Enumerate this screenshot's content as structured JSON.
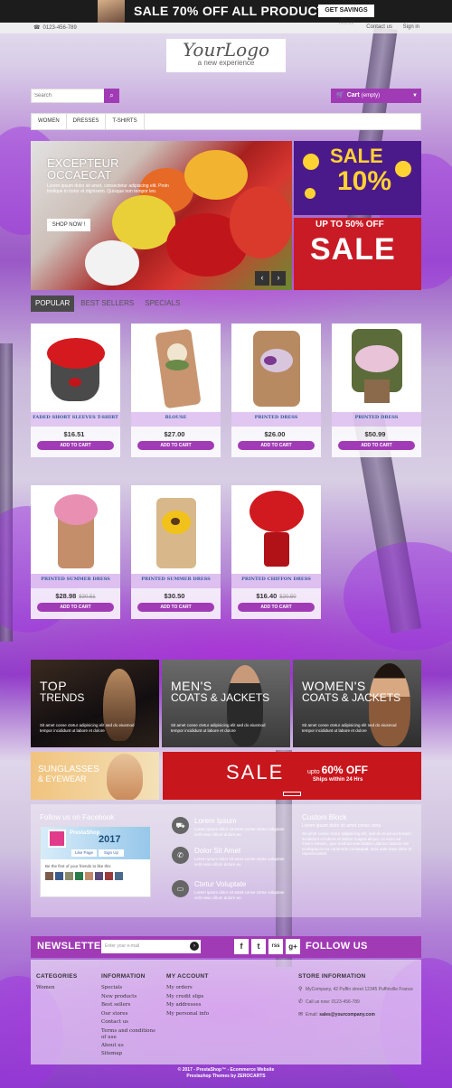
{
  "promo_banner": {
    "text": "SALE 70% OFF ALL PRODUCTS",
    "button": "GET SAVINGS NOW"
  },
  "topbar": {
    "phone": "0123-456-789",
    "contact": "Contact us",
    "signin": "Sign in"
  },
  "logo": {
    "name": "YourLogo",
    "tagline": "a new experience"
  },
  "search": {
    "placeholder": "Search",
    "icon": "search-icon"
  },
  "cart": {
    "label": "Cart",
    "status": "(empty)"
  },
  "menu": [
    "WOMEN",
    "DRESSES",
    "T-SHIRTS"
  ],
  "slider": {
    "heading_1": "EXCEPTEUR",
    "heading_2": "OCCAECAT",
    "text": "Lorem ipsum dolor sit amet, consectetur adipiscing elit. Proin tristique in tortor et dignissim. Quisque non tempor leo.",
    "button": "SHOP NOW !",
    "prev": "‹",
    "next": "›"
  },
  "side_ads": {
    "ad1_line1": "SALE",
    "ad1_line2": "10%",
    "ad2_line1": "UP TO 50% OFF",
    "ad2_line2": "SALE"
  },
  "tabs": [
    "POPULAR",
    "BEST SELLERS",
    "SPECIALS"
  ],
  "products": [
    {
      "name": "FADED SHORT SLEEVES T-SHIRT",
      "price": "$16.51",
      "old_price": "",
      "button": "ADD TO CART"
    },
    {
      "name": "BLOUSE",
      "price": "$27.00",
      "old_price": "",
      "button": "ADD TO CART"
    },
    {
      "name": "PRINTED DRESS",
      "price": "$26.00",
      "old_price": "",
      "button": "ADD TO CART"
    },
    {
      "name": "PRINTED DRESS",
      "price": "$50.99",
      "old_price": "",
      "button": "ADD TO CART"
    },
    {
      "name": "PRINTED SUMMER DRESS",
      "price": "$28.98",
      "old_price": "$30.51",
      "button": "ADD TO CART"
    },
    {
      "name": "PRINTED SUMMER DRESS",
      "price": "$30.50",
      "old_price": "",
      "button": "ADD TO CART"
    },
    {
      "name": "PRINTED CHIFFON DRESS",
      "price": "$16.40",
      "old_price": "$20.50",
      "button": "ADD TO CART"
    }
  ],
  "promos": [
    {
      "title_1": "TOP",
      "title_2": "TRENDS",
      "desc": "Sit amet conse ctetur adipisicing elit sed do eiusmod tempor incididunt ut labore et dolore"
    },
    {
      "title_1": "MEN'S",
      "title_2": "COATS & JACKETS",
      "desc": "Sit amet conse ctetur adipisicing elit sed do eiusmod tempor incididunt ut labore et dolore"
    },
    {
      "title_1": "WOMEN'S",
      "title_2": "COATS & JACKETS",
      "desc": "Sit amet conse ctetur adipisicing elit sed do eiusmod tempor incididunt ut labore et dolore"
    }
  ],
  "sunglasses": {
    "line1": "SUNGLASSES",
    "line2": "& EYEWEAR"
  },
  "sale_bar": {
    "sale": "SALE",
    "upto": "upto",
    "pct": "60% OFF",
    "ships": "Ships within 24 Hrs"
  },
  "facebook": {
    "title": "Follow us on Facebook",
    "page_name": "PrestaShop",
    "year": "2017",
    "like": "Like Page",
    "signup": "Sign Up",
    "first": "Be the first of your friends to like this"
  },
  "services": [
    {
      "title": "Lorem Ipsum",
      "desc": "Lorem ipsum dolor sit amet conse ctetur voluptate velit esse cillum dolore eu",
      "icon": "truck-icon"
    },
    {
      "title": "Dolor Sit Amet",
      "desc": "Lorem ipsum dolor sit amet conse ctetur voluptate velit esse cillum dolore eu",
      "icon": "phone-icon"
    },
    {
      "title": "Ctetur Voluptate",
      "desc": "Lorem ipsum dolor sit amet conse ctetur voluptate velit esse cillum dolore eu",
      "icon": "credit-card-icon"
    }
  ],
  "custom_block": {
    "title": "Custom Block",
    "subtitle": "Lorem ipsum dolor sit amet conse ctetu",
    "desc": "Sit amet conse ctetur adipisicing elit, sed do eiusmod tempor incididunt ut labore et dolore magna aliqua. Ut enim ad minim veniam, quis nostrud exercitation ullamco laboris nisi ut aliquip ex ea commodo consequat. Duis aute irure dolor in reprehenderit."
  },
  "newsletter": {
    "label": "NEWSLETTER",
    "placeholder": "Enter your e-mail",
    "follow": "FOLLOW US"
  },
  "social": [
    "f",
    "t",
    "rss",
    "g+"
  ],
  "footer": {
    "categories_title": "CATEGORIES",
    "categories": [
      "Women"
    ],
    "information_title": "INFORMATION",
    "information": [
      "Specials",
      "New products",
      "Best sellers",
      "Our stores",
      "Contact us",
      "Terms and conditions of use",
      "About us",
      "Sitemap"
    ],
    "account_title": "MY ACCOUNT",
    "account": [
      "My orders",
      "My credit slips",
      "My addresses",
      "My personal info"
    ],
    "store_title": "STORE INFORMATION",
    "address": "MyCompany, 42 Puffin street 12345 Puffinville France",
    "call": "Call us now: 0123-456-789",
    "email_label": "Email:",
    "email": "sales@yourcompany.com"
  },
  "copyright": {
    "line1": "© 2017 - PrestaShop™ - Ecommerce Website",
    "line2": "Prestashop Themes by ZEROCARTS"
  },
  "colors": {
    "accent": "#a13bb5",
    "banner": "#1c1c1c",
    "sale_red": "#c8161d"
  }
}
